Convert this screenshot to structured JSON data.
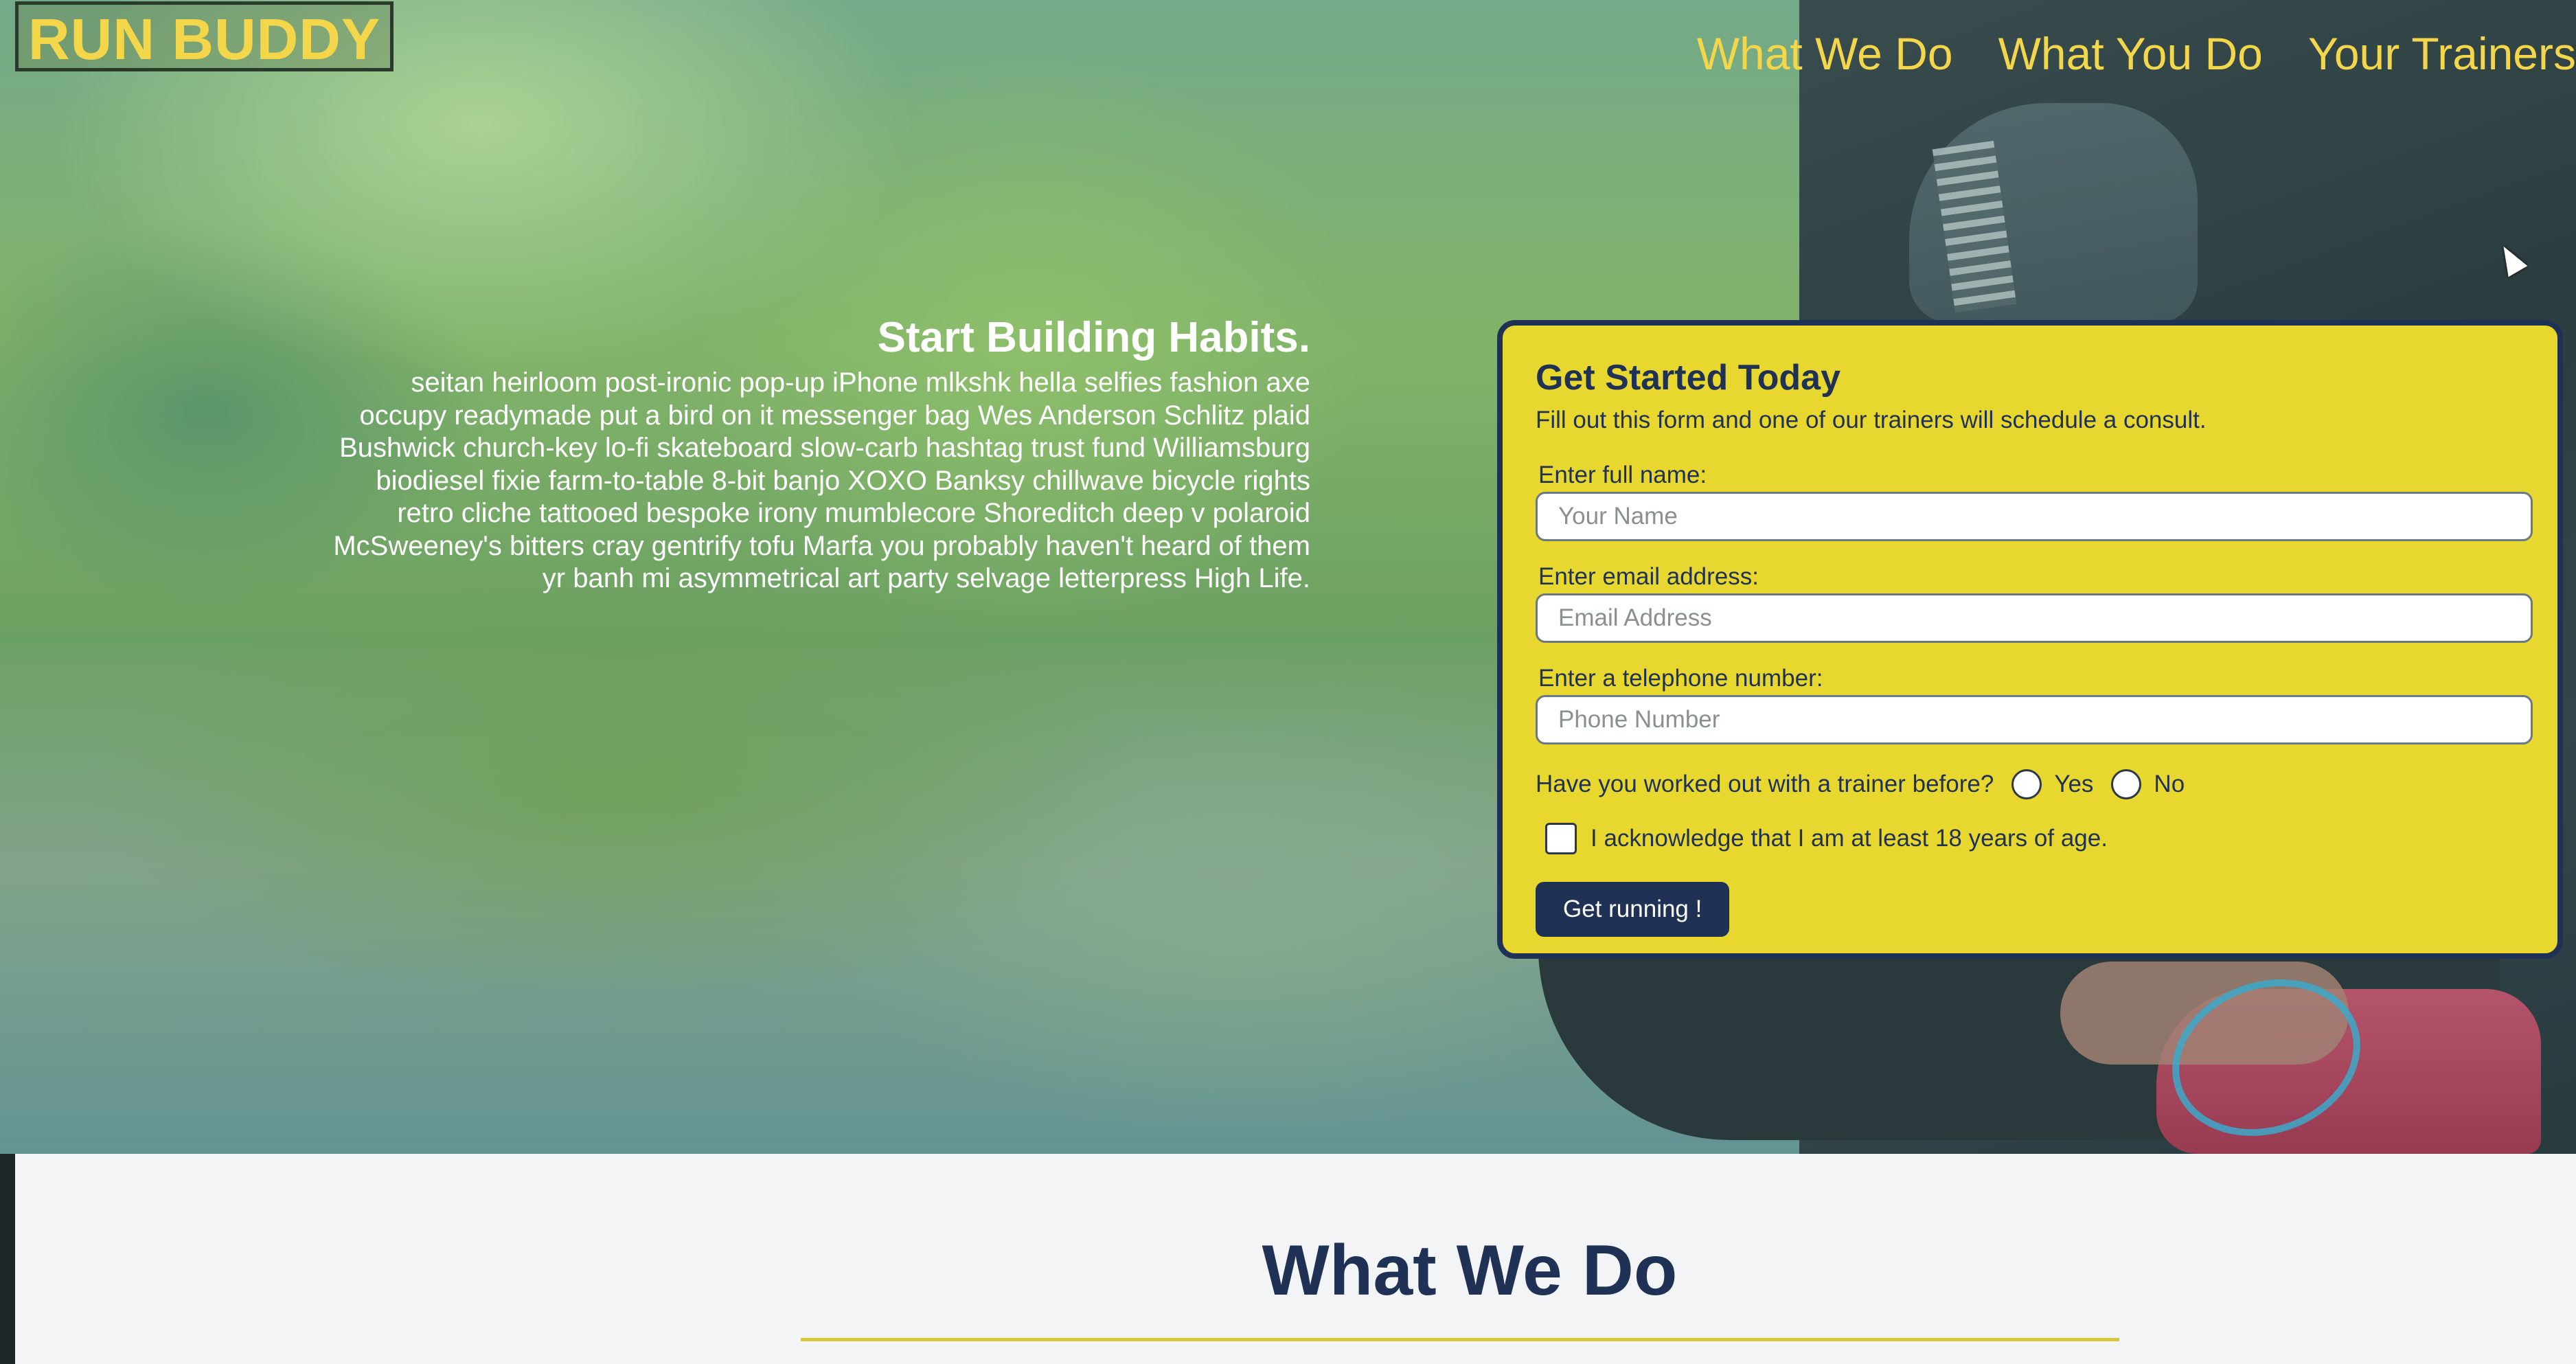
{
  "header": {
    "logo": "RUN BUDDY",
    "nav": [
      "What We Do",
      "What You Do",
      "Your Trainers"
    ]
  },
  "hero": {
    "title": "Start Building Habits.",
    "body": "seitan heirloom post-ironic pop-up iPhone mlkshk hella selfies fashion axe occupy readymade put a bird on it messenger bag Wes Anderson Schlitz plaid Bushwick church-key lo-fi skateboard slow-carb hashtag trust fund Williamsburg biodiesel fixie farm-to-table 8-bit banjo XOXO Banksy chillwave bicycle rights retro cliche tattooed bespoke irony mumblecore Shoreditch deep v polaroid McSweeney's bitters cray gentrify tofu Marfa you probably haven't heard of them yr banh mi asymmetrical art party selvage letterpress High Life."
  },
  "form": {
    "title": "Get Started Today",
    "intro": "Fill out this form and one of our trainers will schedule a consult.",
    "name_label": "Enter full name:",
    "name_placeholder": "Your Name",
    "email_label": "Enter email address:",
    "email_placeholder": "Email Address",
    "phone_label": "Enter a telephone number:",
    "phone_placeholder": "Phone Number",
    "trainer_question": "Have you worked out with a trainer before?",
    "yes_label": "Yes",
    "no_label": "No",
    "acknowledge_label": "I acknowledge that I am at least 18 years of age.",
    "submit_label": "Get running !"
  },
  "section": {
    "title": "What We Do"
  },
  "colors": {
    "accent_yellow": "#e8d72e",
    "brand_navy": "#1f3154",
    "nav_text": "#f3d64a"
  },
  "icons": [
    "mouse-pointer-icon"
  ]
}
